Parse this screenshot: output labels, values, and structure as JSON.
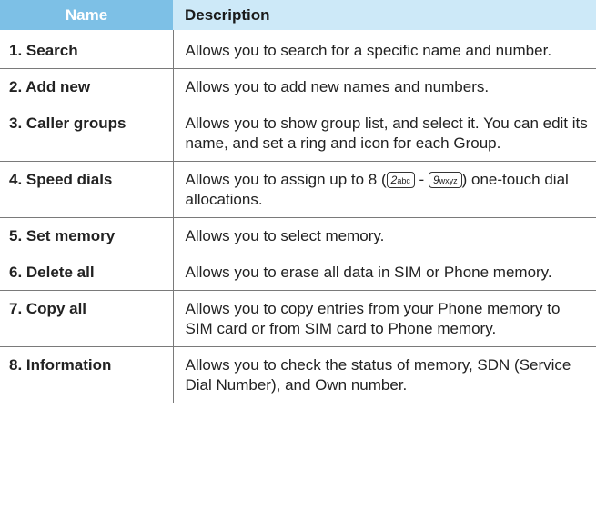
{
  "table": {
    "headers": {
      "name": "Name",
      "description": "Description"
    },
    "rows": [
      {
        "name": "1. Search",
        "description": "Allows you to search for a specific name and number."
      },
      {
        "name": "2. Add new",
        "description": "Allows you to add new names and numbers."
      },
      {
        "name": "3. Caller groups",
        "description": "Allows you to show group list, and select it. You can edit its name, and set a ring and icon for each Group."
      },
      {
        "name": "4. Speed dials",
        "description_before": "Allows you to assign up to 8 (",
        "key_from": {
          "digit": "2",
          "letters": "abc"
        },
        "description_between": " - ",
        "key_to": {
          "digit": "9",
          "letters": "wxyz"
        },
        "description_after": ") one-touch dial allocations."
      },
      {
        "name": "5. Set memory",
        "description": "Allows you to select memory."
      },
      {
        "name": "6. Delete all",
        "description": "Allows you to erase all data in SIM or Phone memory."
      },
      {
        "name": "7. Copy all",
        "description": "Allows you to copy entries from your Phone memory to SIM card or from SIM card to Phone memory."
      },
      {
        "name": "8. Information",
        "description": "Allows you to check the status of memory, SDN (Service Dial Number), and Own number."
      }
    ]
  }
}
